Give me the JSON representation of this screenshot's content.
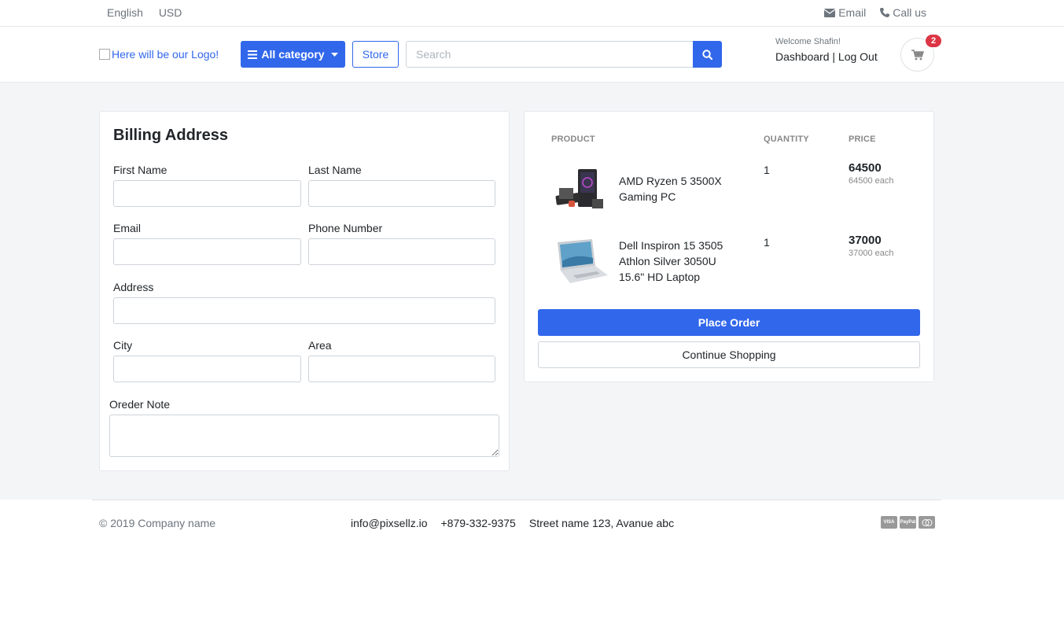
{
  "topbar": {
    "language": "English",
    "currency": "USD",
    "email_label": "Email",
    "call_label": "Call us"
  },
  "header": {
    "logo_alt": "Here will be our Logo!",
    "category_label": "All category",
    "store_label": "Store",
    "search_placeholder": "Search",
    "welcome_text": "Welcome Shafin!",
    "dashboard_label": "Dashboard",
    "separator": "|",
    "logout_label": "Log Out",
    "cart_count": "2"
  },
  "billing": {
    "title": "Billing Address",
    "first_name_label": "First Name",
    "last_name_label": "Last Name",
    "email_label": "Email",
    "phone_label": "Phone Number",
    "address_label": "Address",
    "city_label": "City",
    "area_label": "Area",
    "note_label": "Oreder Note"
  },
  "order": {
    "col_product": "PRODUCT",
    "col_quantity": "QUANTITY",
    "col_price": "PRICE",
    "items": [
      {
        "name": "AMD Ryzen 5 3500X Gaming PC",
        "quantity": "1",
        "price": "64500",
        "each": "64500 each"
      },
      {
        "name": "Dell Inspiron 15 3505 Athlon Silver 3050U 15.6\" HD Laptop",
        "quantity": "1",
        "price": "37000",
        "each": "37000 each"
      }
    ],
    "place_order_label": "Place Order",
    "continue_label": "Continue Shopping"
  },
  "footer": {
    "copyright": "© 2019 Company name",
    "email": "info@pixsellz.io",
    "phone": "+879-332-9375",
    "address": "Street name 123, Avanue abc",
    "payment_icons": [
      "visa-icon",
      "paypal-icon",
      "mastercard-icon"
    ]
  },
  "colors": {
    "primary": "#3167eb",
    "badge": "#dc3545",
    "page_bg": "#f4f5f7"
  }
}
